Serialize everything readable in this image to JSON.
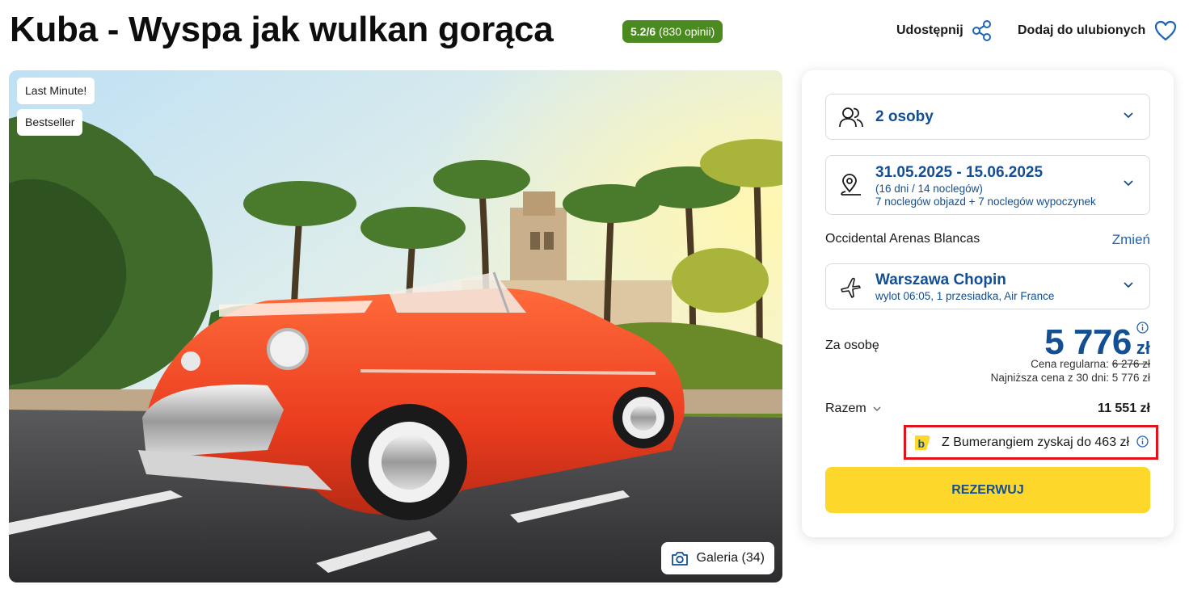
{
  "header": {
    "title": "Kuba - Wyspa jak wulkan gorąca",
    "rating_score": "5.2/6",
    "rating_count": "(830 opinii)",
    "share_label": "Udostępnij",
    "favorite_label": "Dodaj do ulubionych",
    "rating_color": "#4a8a1e"
  },
  "photo": {
    "badges": [
      "Last Minute!",
      "Bestseller"
    ],
    "gallery_label": "Galeria (34)"
  },
  "booking": {
    "persons": "2 osoby",
    "dates": "31.05.2025 - 15.06.2025",
    "dates_sub1": "(16 dni / 14 noclegów)",
    "dates_sub2": "7 noclegów objazd + 7 noclegów wypoczynek",
    "hotel": "Occidental Arenas Blancas",
    "change_label": "Zmień",
    "airport": "Warszawa Chopin",
    "flight_info": "wylot 06:05, 1 przesiadka, Air France",
    "per_person_label": "Za osobę",
    "price": "5 776",
    "currency": "zł",
    "regular_label": "Cena regularna:",
    "regular_price": "6 276 zł",
    "lowest_price": "Najniższa cena z 30 dni: 5 776 zł",
    "total_label": "Razem",
    "total_value": "11 551 zł",
    "bumerang_text": "Z Bumerangiem zyskaj do 463 zł",
    "reserve_label": "REZERWUJ",
    "accent_color": "#134f92",
    "button_color": "#fdd82a"
  }
}
